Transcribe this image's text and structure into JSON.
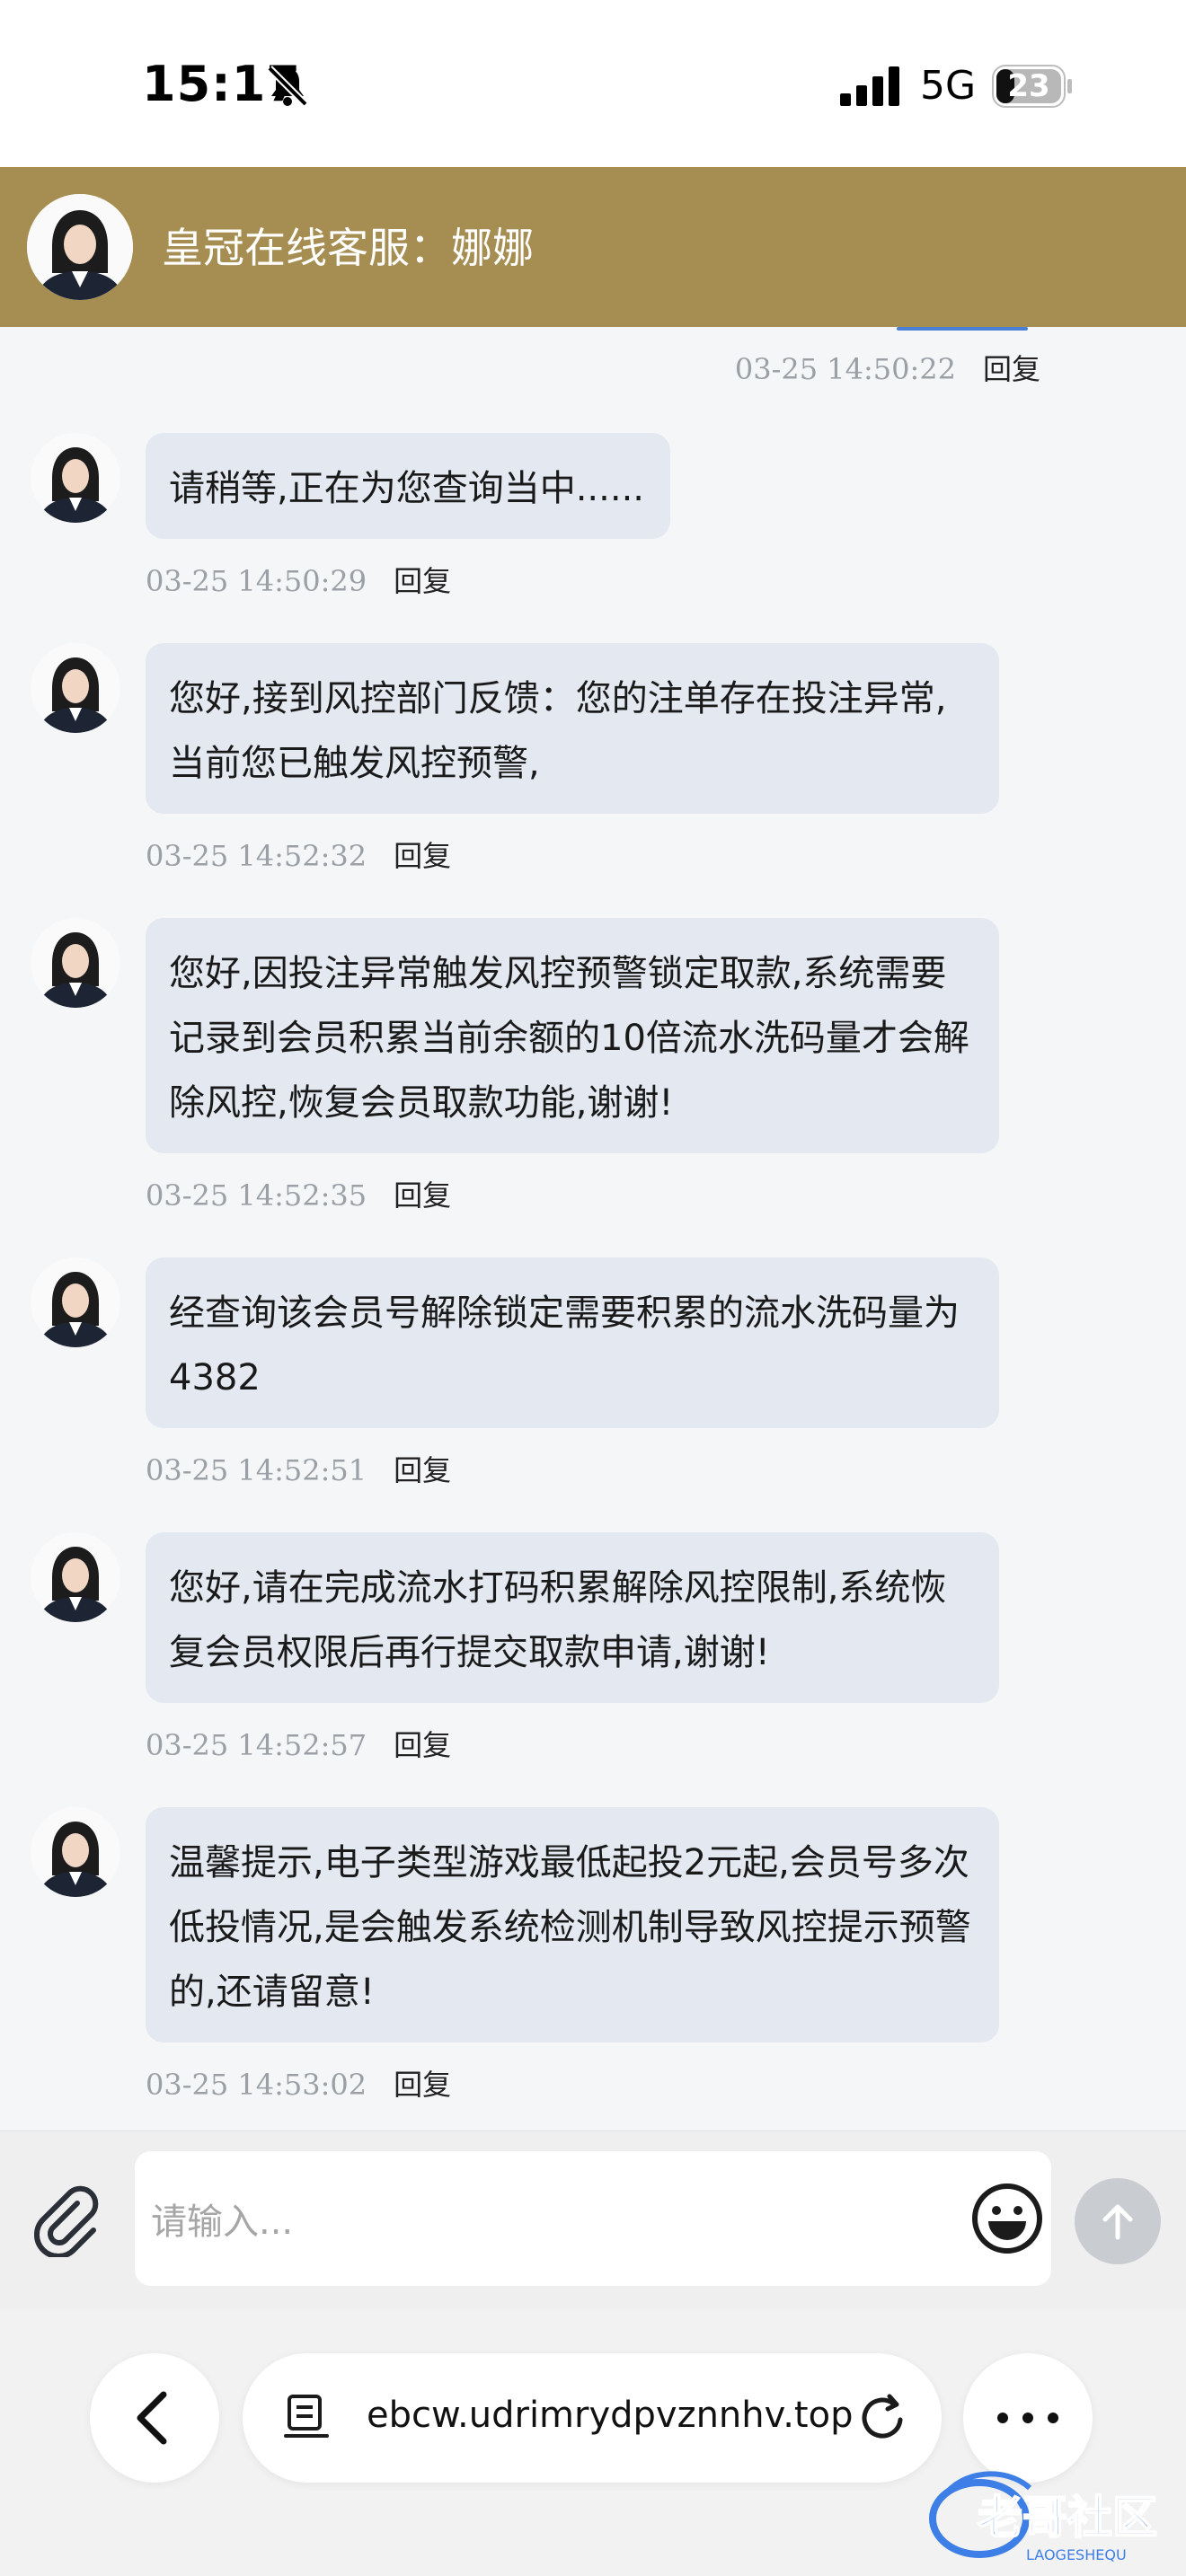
{
  "status_bar": {
    "time": "15:17",
    "network": "5G",
    "battery": "23"
  },
  "header": {
    "title": "皇冠在线客服：娜娜"
  },
  "outgoing": {
    "timestamp": "03-25 14:50:22",
    "reply_label": "回复"
  },
  "messages": [
    {
      "text": "请稍等,正在为您查询当中......",
      "timestamp": "03-25 14:50:29",
      "reply_label": "回复"
    },
    {
      "text": "您好,接到风控部门反馈：您的注单存在投注异常,当前您已触发风控预警,",
      "timestamp": "03-25 14:52:32",
      "reply_label": "回复"
    },
    {
      "text": "您好,因投注异常触发风控预警锁定取款,系统需要记录到会员积累当前余额的10倍流水洗码量才会解除风控,恢复会员取款功能,谢谢!",
      "timestamp": "03-25 14:52:35",
      "reply_label": "回复"
    },
    {
      "text": "经查询该会员号解除锁定需要积累的流水洗码量为4382",
      "timestamp": "03-25 14:52:51",
      "reply_label": "回复"
    },
    {
      "text": "您好,请在完成流水打码积累解除风控限制,系统恢复会员权限后再行提交取款申请,谢谢!",
      "timestamp": "03-25 14:52:57",
      "reply_label": "回复"
    },
    {
      "text": "温馨提示,电子类型游戏最低起投2元起,会员号多次低投情况,是会触发系统检测机制导致风控提示预警的,还请留意!",
      "timestamp": "03-25 14:53:02",
      "reply_label": "回复"
    }
  ],
  "input": {
    "placeholder": "请输入..."
  },
  "browser": {
    "url": "ebcw.udrimrydpvznnhv.top"
  },
  "watermark": {
    "text": "老哥社区",
    "subtext": "LAOGESHEQU"
  },
  "icons": {
    "status": [
      "bell-slash-icon",
      "signal-icon",
      "battery-icon"
    ],
    "input": [
      "paperclip-icon",
      "emoji-icon",
      "arrow-up-icon"
    ],
    "browser": [
      "chevron-left-icon",
      "page-icon",
      "reload-icon",
      "more-icon"
    ]
  },
  "colors": {
    "header_bg": "#a68d52",
    "bubble_bg": "#e4e9f1",
    "timestamp": "#9aa0a6",
    "send_button": "#c9cdd2"
  }
}
